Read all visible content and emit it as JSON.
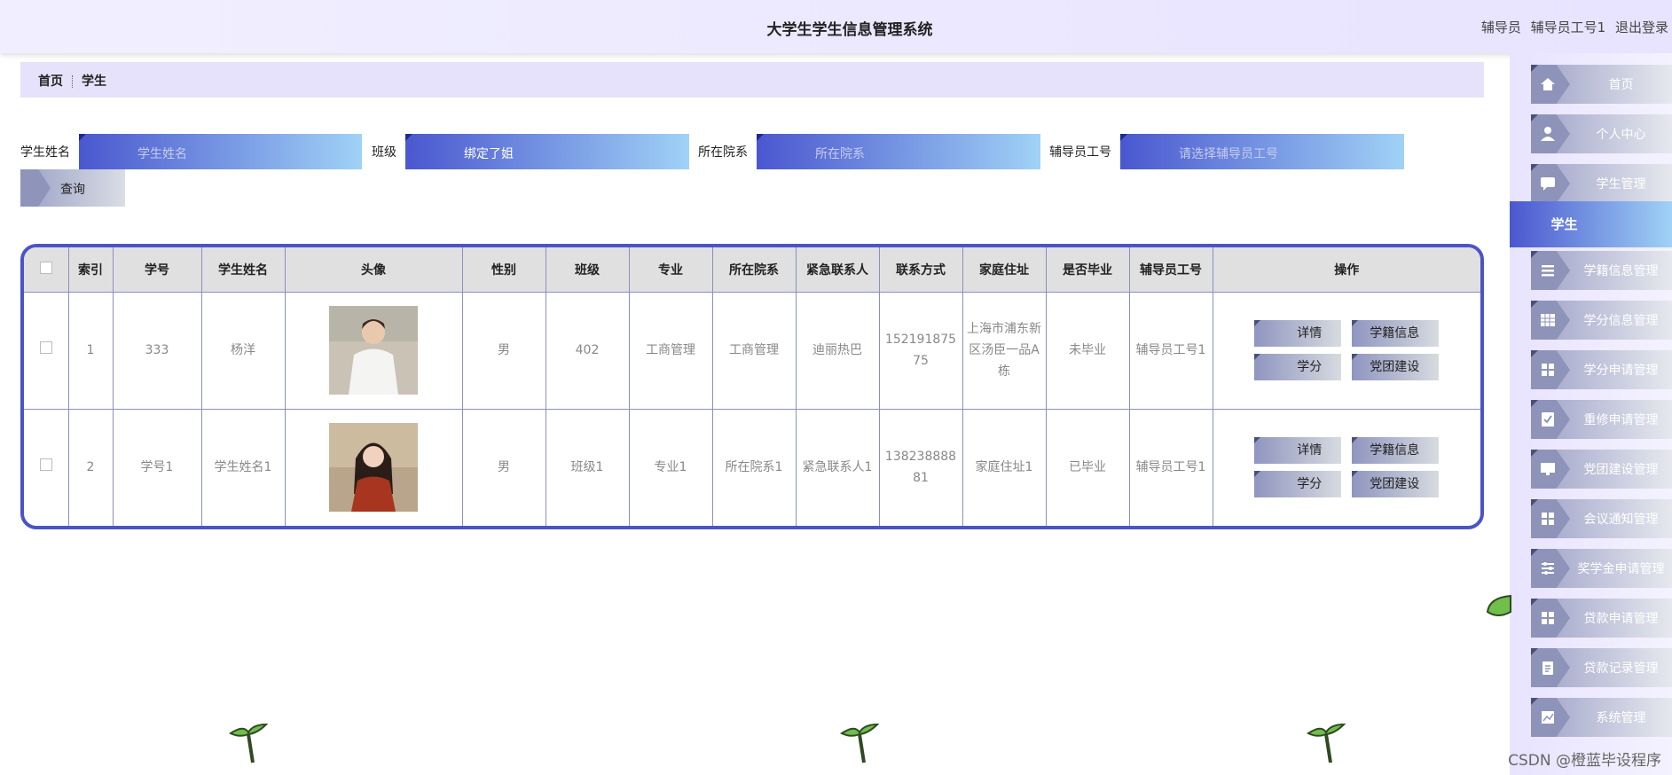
{
  "header": {
    "title": "大学生学生信息管理系统",
    "role": "辅导员",
    "user": "辅导员工号1",
    "logout": "退出登录"
  },
  "breadcrumb": {
    "home": "首页",
    "current": "学生"
  },
  "search": {
    "name_label": "学生姓名",
    "name_placeholder": "学生姓名",
    "class_label": "班级",
    "class_value": "绑定了姐",
    "college_label": "所在院系",
    "college_placeholder": "所在院系",
    "counselor_label": "辅导员工号",
    "counselor_placeholder": "请选择辅导员工号",
    "query_label": "查询"
  },
  "table": {
    "headers": [
      "索引",
      "学号",
      "学生姓名",
      "头像",
      "性别",
      "班级",
      "专业",
      "所在院系",
      "紧急联系人",
      "联系方式",
      "家庭住址",
      "是否毕业",
      "辅导员工号",
      "操作"
    ],
    "rows": [
      {
        "index": "1",
        "sno": "333",
        "name": "杨洋",
        "gender": "男",
        "class": "402",
        "major": "工商管理",
        "college": "工商管理",
        "contact": "迪丽热巴",
        "phone": "15219187575",
        "address": "上海市浦东新区汤臣一品A栋",
        "graduated": "未毕业",
        "counselor": "辅导员工号1"
      },
      {
        "index": "2",
        "sno": "学号1",
        "name": "学生姓名1",
        "gender": "男",
        "class": "班级1",
        "major": "专业1",
        "college": "所在院系1",
        "contact": "紧急联系人1",
        "phone": "13823888881",
        "address": "家庭住址1",
        "graduated": "已毕业",
        "counselor": "辅导员工号1"
      }
    ],
    "actions": {
      "detail": "详情",
      "status": "学籍信息",
      "credit": "学分",
      "party": "党团建设"
    }
  },
  "sidebar": {
    "items": [
      {
        "label": "首页",
        "icon": "home-icon"
      },
      {
        "label": "个人中心",
        "icon": "user-icon"
      },
      {
        "label": "学生管理",
        "icon": "chat-icon"
      },
      {
        "label": "学籍信息管理",
        "icon": "list-icon"
      },
      {
        "label": "学分信息管理",
        "icon": "grid-icon"
      },
      {
        "label": "学分申请管理",
        "icon": "apps-icon"
      },
      {
        "label": "重修申请管理",
        "icon": "check-icon"
      },
      {
        "label": "党团建设管理",
        "icon": "monitor-icon"
      },
      {
        "label": "会议通知管理",
        "icon": "apps-icon"
      },
      {
        "label": "奖学金申请管理",
        "icon": "sliders-icon"
      },
      {
        "label": "贷款申请管理",
        "icon": "apps-icon"
      },
      {
        "label": "贷款记录管理",
        "icon": "clipboard-icon"
      },
      {
        "label": "系统管理",
        "icon": "chart-icon"
      }
    ],
    "active": "学生"
  },
  "watermark": "CSDN @橙蓝毕设程序"
}
